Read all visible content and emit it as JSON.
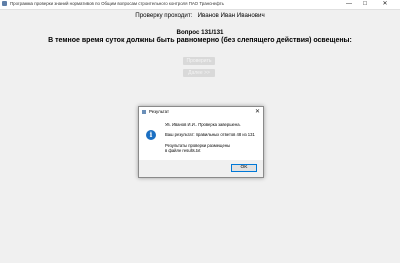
{
  "window": {
    "title": "Программа проверки знаний нормативов по Общим вопросам строительного контроля ПАО Транснефть",
    "min_glyph": "—",
    "max_glyph": "☐",
    "close_glyph": "✕"
  },
  "main": {
    "tester_label": "Проверку проходит:",
    "tester_name": "Иванов Иван Иванович",
    "question_number": "Вопрос 131/131",
    "question_text": "В темное время суток должны быть равномерно (без слепящего действия) освещены:",
    "check_button": "Проверить",
    "next_button": "Далее >>"
  },
  "dialog": {
    "title": "Результат",
    "icon": "info-icon",
    "close_glyph": "✕",
    "line1": "Ув. Иванов И.И.. Проверка завершена.",
    "line2": "Ваш результат: правильных ответов 48 из 131",
    "line3": "Результаты проверки размещены",
    "line4": "в файле results.txt",
    "ok_label": "OK"
  }
}
